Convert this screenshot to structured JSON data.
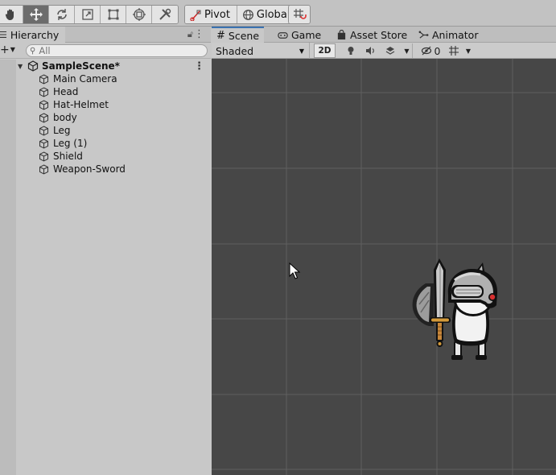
{
  "toolbar": {
    "tools": [
      "hand-tool",
      "move-tool",
      "rotate-tool",
      "scale-tool",
      "rect-tool",
      "transform-tool",
      "custom-tools"
    ],
    "active_tool": "move-tool",
    "pivot_label": "Pivot",
    "global_label": "Global"
  },
  "hierarchy": {
    "tab_label": "Hierarchy",
    "search_placeholder": "All",
    "scene_name": "SampleScene*",
    "objects": [
      "Main Camera",
      "Head",
      "Hat-Helmet",
      "body",
      "Leg",
      "Leg (1)",
      "Shield",
      "Weapon-Sword"
    ]
  },
  "scene": {
    "tabs": [
      {
        "label": "Scene",
        "icon": "grid-icon"
      },
      {
        "label": "Game",
        "icon": "gamepad-icon"
      },
      {
        "label": "Asset Store",
        "icon": "store-bag-icon"
      },
      {
        "label": "Animator",
        "icon": "animator-icon"
      }
    ],
    "shading_mode": "Shaded",
    "mode_2d_label": "2D",
    "hidden_count": "0"
  },
  "colors": {
    "viewport_bg": "#474747",
    "grid_line": "#5f5f5f",
    "active_tab_accent": "#3a72b0"
  }
}
